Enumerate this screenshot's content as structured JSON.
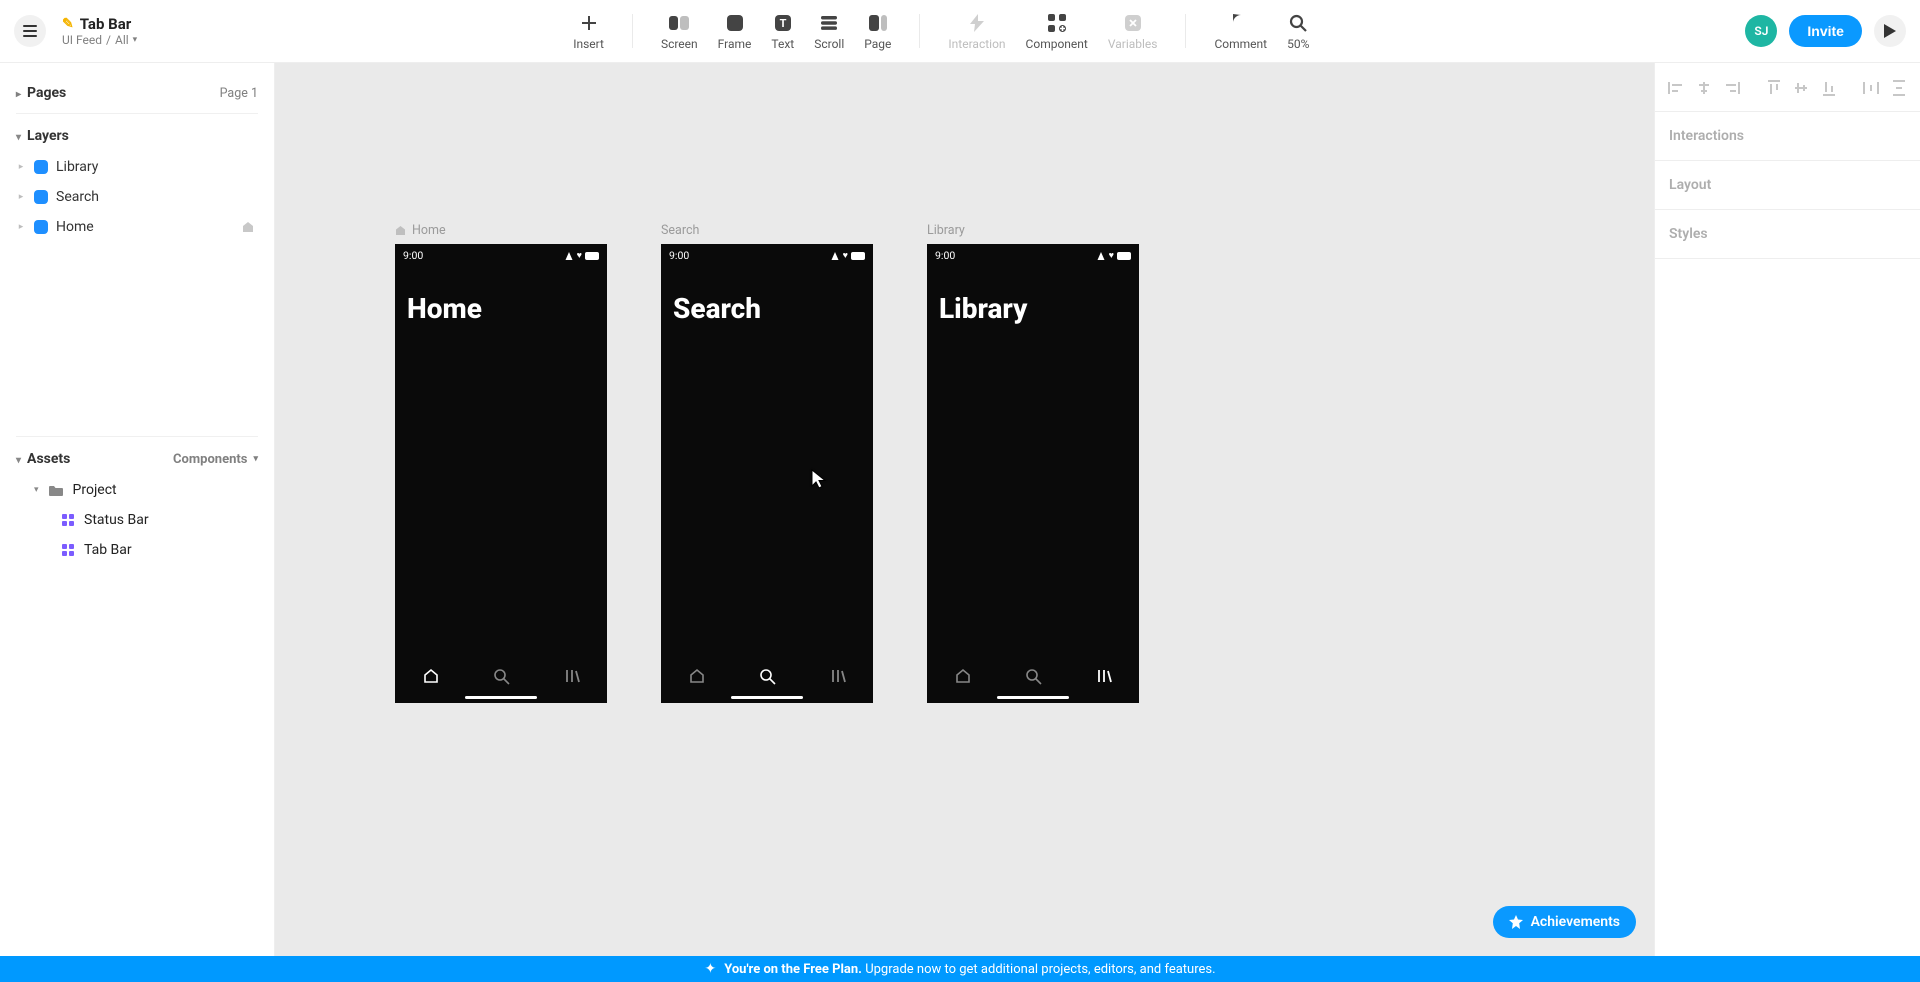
{
  "header": {
    "project_name": "Tab Bar",
    "breadcrumb_team": "UI Feed",
    "breadcrumb_folder": "All",
    "avatar_initials": "SJ",
    "invite_label": "Invite"
  },
  "tools": {
    "insert": "Insert",
    "screen": "Screen",
    "frame": "Frame",
    "text": "Text",
    "scroll": "Scroll",
    "page": "Page",
    "interaction": "Interaction",
    "component": "Component",
    "variables": "Variables",
    "comment": "Comment",
    "zoom": "50%"
  },
  "left": {
    "pages_label": "Pages",
    "page_meta": "Page 1",
    "layers_label": "Layers",
    "layers": [
      {
        "name": "Library"
      },
      {
        "name": "Search"
      },
      {
        "name": "Home"
      }
    ],
    "assets_label": "Assets",
    "assets_filter": "Components",
    "project_folder": "Project",
    "assets": [
      {
        "name": "Status Bar"
      },
      {
        "name": "Tab Bar"
      }
    ]
  },
  "canvas": {
    "status_time": "9:00",
    "frames": [
      {
        "label": "Home",
        "title": "Home",
        "active_tab": 0,
        "has_home_icon": true
      },
      {
        "label": "Search",
        "title": "Search",
        "active_tab": 1,
        "has_home_icon": false
      },
      {
        "label": "Library",
        "title": "Library",
        "active_tab": 2,
        "has_home_icon": false
      }
    ],
    "achievements_label": "Achievements"
  },
  "right": {
    "interactions": "Interactions",
    "layout": "Layout",
    "styles": "Styles"
  },
  "banner": {
    "bold": "You're on the Free Plan.",
    "rest": "Upgrade now to get additional projects, editors, and features."
  }
}
